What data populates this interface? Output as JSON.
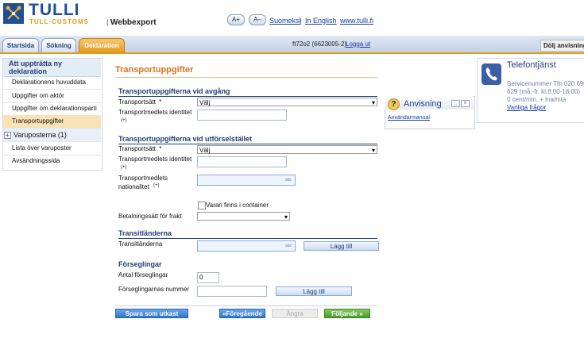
{
  "header": {
    "logo_main": "TULLI",
    "logo_sub": "TULL·CUSTOMS",
    "logo_sep": "|",
    "app_name": "Webbexport",
    "font_increase": "A+",
    "font_decrease": "A–",
    "lang_fi": "Suomeksi",
    "sep1": "|",
    "lang_en": "In English",
    "site_link": "www.tulli.fi"
  },
  "tabs": [
    {
      "label": "Startsida"
    },
    {
      "label": "Sökning"
    },
    {
      "label": "Deklaration"
    }
  ],
  "userbar": {
    "user": "ft72o2 (6623005-2)",
    "logout": "Logga ut",
    "hide_help": "Dölj anvisningar"
  },
  "nav": {
    "heading": "Att uppträtta ny deklaration",
    "items": [
      {
        "label": "Deklarationens huvuddata"
      },
      {
        "label": "Uppgifter om aktör"
      },
      {
        "label": "Uppgifter om deklarationsparti"
      },
      {
        "label": "Transportuppgifter"
      },
      {
        "label": "Varuposterna (1)"
      },
      {
        "label": "Lista över varuposter"
      },
      {
        "label": "Avsändningssida"
      }
    ],
    "expander": "+"
  },
  "main": {
    "title": "Transportuppgifter",
    "departure": {
      "heading": "Transportuppgifterna vid avgång",
      "mode_label": "Transportsätt",
      "required_mark": "*",
      "mode_value": "Välj",
      "identity_label": "Transportmedlets identitet",
      "optional_mark": "(+)"
    },
    "exit": {
      "heading": "Transportuppgifterna vid utförselstället",
      "mode_label": "Transportsätt",
      "required_mark": "*",
      "mode_value": "Välj",
      "identity_label": "Transportmedlets identitet",
      "identity_mark": "(+)",
      "nationality_label_1": "Transportmedlets",
      "nationality_label_2": "nationalitet",
      "nationality_mark": "(+)",
      "abc": "abc",
      "container_label": "Varan finns i container",
      "payment_label": "Betalningssätt för frakt"
    },
    "transit": {
      "heading": "Transitländerna",
      "label": "Transitländerna",
      "abc": "abc",
      "add": "Lägg till"
    },
    "seals": {
      "heading": "Förseglingar",
      "count_label": "Antal förseglingar",
      "count_value": "0",
      "numbers_label": "Förseglingarnas nummer",
      "add": "Lägg till"
    },
    "footer": {
      "save_draft": "Spara som utkast",
      "previous": "«Föregående",
      "undo": "Ångra",
      "next": "Följande »"
    }
  },
  "help": {
    "icon": "?",
    "title": "Anvisning",
    "minimize": "_",
    "close": "x",
    "link": "Användarmanual"
  },
  "phone": {
    "title": "Telefontjänst",
    "line1": "Servicenummer Tfn 020 690",
    "line2": "629 (må.-fr. kl.8:00-18:00)",
    "line3": "0 cent/min. + lna/mta",
    "link": "Vanliga frågor"
  },
  "colors": {
    "brand_blue": "#1f4f95",
    "accent_orange": "#e29a1b",
    "title_orange": "#d4731a",
    "save_button": "#3d84d6",
    "next_button": "#58a83a"
  }
}
